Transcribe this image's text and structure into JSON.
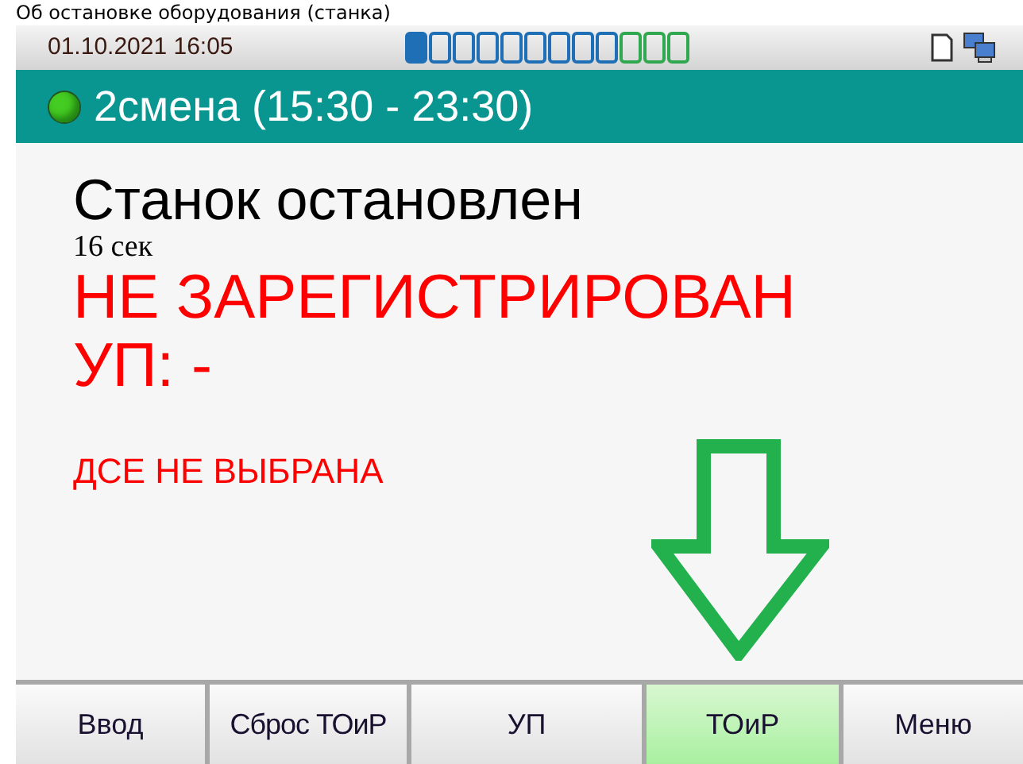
{
  "caption": "Об остановке оборудования (станка)",
  "status_bar": {
    "datetime": "01.10.2021 16:05",
    "segments": [
      {
        "filled": true,
        "color": "#1e6fb5"
      },
      {
        "filled": false,
        "color": "#1e6fb5"
      },
      {
        "filled": false,
        "color": "#1e6fb5"
      },
      {
        "filled": false,
        "color": "#1e6fb5"
      },
      {
        "filled": false,
        "color": "#1e6fb5"
      },
      {
        "filled": false,
        "color": "#1e6fb5"
      },
      {
        "filled": false,
        "color": "#1e6fb5"
      },
      {
        "filled": false,
        "color": "#1e6fb5"
      },
      {
        "filled": false,
        "color": "#1e6fb5"
      },
      {
        "filled": false,
        "color": "#2fa84f"
      },
      {
        "filled": false,
        "color": "#2fa84f"
      },
      {
        "filled": false,
        "color": "#2fa84f"
      }
    ]
  },
  "shift": {
    "label": "2смена (15:30 - 23:30)",
    "color": "#44cc22"
  },
  "machine": {
    "state": "Станок остановлен",
    "duration": "16 сек",
    "registration": "НЕ ЗАРЕГИСТРИРОВАН",
    "program": "УП: -",
    "part": "ДСЕ НЕ ВЫБРАНА"
  },
  "buttons": [
    {
      "label": "Ввод",
      "selected": false
    },
    {
      "label": "Сброс ТОиР",
      "selected": false
    },
    {
      "label": "УП",
      "selected": false
    },
    {
      "label": "ТОиР",
      "selected": true
    },
    {
      "label": "Меню",
      "selected": false
    }
  ]
}
